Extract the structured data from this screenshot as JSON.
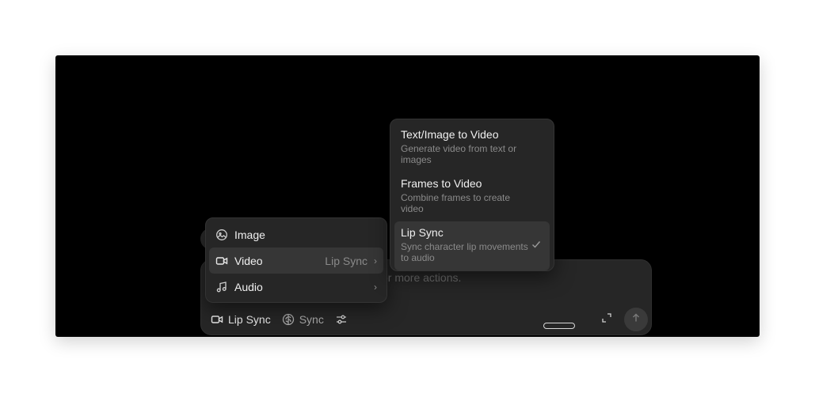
{
  "composer": {
    "placeholder": "or more actions.",
    "toolbar": {
      "mode_label": "Lip Sync",
      "model_label": "Sync"
    },
    "icons": [
      "video-icon",
      "brain-icon",
      "sliders-icon",
      "expand-icon",
      "arrow-up-icon"
    ]
  },
  "menu": {
    "items": [
      {
        "label": "Image",
        "icon": "image-icon",
        "right_text": "",
        "has_submenu": false
      },
      {
        "label": "Video",
        "icon": "video-icon",
        "right_text": "Lip Sync",
        "has_submenu": true,
        "active": true
      },
      {
        "label": "Audio",
        "icon": "music-icon",
        "right_text": "",
        "has_submenu": true
      }
    ]
  },
  "submenu": {
    "items": [
      {
        "title": "Text/Image to Video",
        "description": "Generate video from text or images"
      },
      {
        "title": "Frames to Video",
        "description": "Combine frames to create video"
      },
      {
        "title": "Lip Sync",
        "description": "Sync character lip movements to audio",
        "selected": true
      }
    ]
  },
  "colors": {
    "canvas": "#000000",
    "panel": "#262626",
    "active": "#363636",
    "text": "#f0f0f0",
    "muted": "#8a8a8a"
  }
}
